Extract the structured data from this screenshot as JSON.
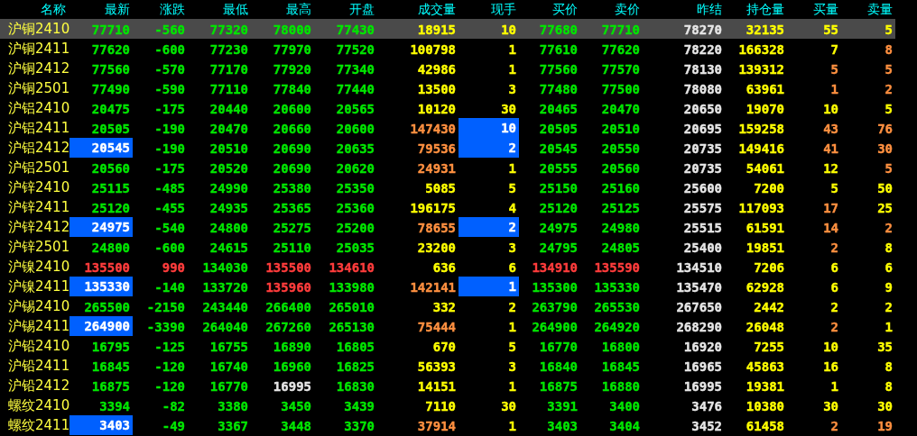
{
  "columns": [
    "名称",
    "最新",
    "涨跌",
    "最低",
    "最高",
    "开盘",
    "成交量",
    "现手",
    "买价",
    "卖价",
    "昨结",
    "持仓量",
    "买量",
    "卖量"
  ],
  "rows": [
    {
      "name": "沪铜2410",
      "selected": true,
      "cells": [
        {
          "text": "77710",
          "color": "#00e600"
        },
        {
          "text": "-560",
          "color": "#00e600"
        },
        {
          "text": "77320",
          "color": "#00e600"
        },
        {
          "text": "78000",
          "color": "#00e600"
        },
        {
          "text": "77430",
          "color": "#00e600"
        },
        {
          "text": "18915",
          "color": "#ffff00"
        },
        {
          "text": "10",
          "color": "#ffff00"
        },
        {
          "text": "77680",
          "color": "#00e600"
        },
        {
          "text": "77710",
          "color": "#00e600"
        },
        {
          "text": "78270",
          "color": "#e6e6e6"
        },
        {
          "text": "32135",
          "color": "#ffff00"
        },
        {
          "text": "55",
          "color": "#ffff00"
        },
        {
          "text": "5",
          "color": "#ffff00"
        }
      ]
    },
    {
      "name": "沪铜2411",
      "selected": false,
      "cells": [
        {
          "text": "77620",
          "color": "#00e600"
        },
        {
          "text": "-600",
          "color": "#00e600"
        },
        {
          "text": "77230",
          "color": "#00e600"
        },
        {
          "text": "77970",
          "color": "#00e600"
        },
        {
          "text": "77520",
          "color": "#00e600"
        },
        {
          "text": "100798",
          "color": "#ffff00"
        },
        {
          "text": "1",
          "color": "#ffff00"
        },
        {
          "text": "77610",
          "color": "#00e600"
        },
        {
          "text": "77620",
          "color": "#00e600"
        },
        {
          "text": "78220",
          "color": "#e6e6e6"
        },
        {
          "text": "166328",
          "color": "#ffff00"
        },
        {
          "text": "7",
          "color": "#ffff00"
        },
        {
          "text": "8",
          "color": "#ff9040"
        }
      ]
    },
    {
      "name": "沪铜2412",
      "selected": false,
      "cells": [
        {
          "text": "77560",
          "color": "#00e600"
        },
        {
          "text": "-570",
          "color": "#00e600"
        },
        {
          "text": "77170",
          "color": "#00e600"
        },
        {
          "text": "77920",
          "color": "#00e600"
        },
        {
          "text": "77340",
          "color": "#00e600"
        },
        {
          "text": "42986",
          "color": "#ffff00"
        },
        {
          "text": "1",
          "color": "#ffff00"
        },
        {
          "text": "77560",
          "color": "#00e600"
        },
        {
          "text": "77570",
          "color": "#00e600"
        },
        {
          "text": "78130",
          "color": "#e6e6e6"
        },
        {
          "text": "139312",
          "color": "#ffff00"
        },
        {
          "text": "5",
          "color": "#ff9040"
        },
        {
          "text": "5",
          "color": "#ff9040"
        }
      ]
    },
    {
      "name": "沪铜2501",
      "selected": false,
      "cells": [
        {
          "text": "77490",
          "color": "#00e600"
        },
        {
          "text": "-590",
          "color": "#00e600"
        },
        {
          "text": "77110",
          "color": "#00e600"
        },
        {
          "text": "77840",
          "color": "#00e600"
        },
        {
          "text": "77440",
          "color": "#00e600"
        },
        {
          "text": "13500",
          "color": "#ffff00"
        },
        {
          "text": "3",
          "color": "#ffff00"
        },
        {
          "text": "77480",
          "color": "#00e600"
        },
        {
          "text": "77500",
          "color": "#00e600"
        },
        {
          "text": "78080",
          "color": "#e6e6e6"
        },
        {
          "text": "63961",
          "color": "#ffff00"
        },
        {
          "text": "1",
          "color": "#ff9040"
        },
        {
          "text": "2",
          "color": "#ff9040"
        }
      ]
    },
    {
      "name": "沪铝2410",
      "selected": false,
      "cells": [
        {
          "text": "20475",
          "color": "#00e600"
        },
        {
          "text": "-175",
          "color": "#00e600"
        },
        {
          "text": "20440",
          "color": "#00e600"
        },
        {
          "text": "20600",
          "color": "#00e600"
        },
        {
          "text": "20565",
          "color": "#00e600"
        },
        {
          "text": "10120",
          "color": "#ffff00"
        },
        {
          "text": "30",
          "color": "#ffff00"
        },
        {
          "text": "20465",
          "color": "#00e600"
        },
        {
          "text": "20470",
          "color": "#00e600"
        },
        {
          "text": "20650",
          "color": "#e6e6e6"
        },
        {
          "text": "19070",
          "color": "#ffff00"
        },
        {
          "text": "10",
          "color": "#ffff00"
        },
        {
          "text": "5",
          "color": "#ffff00"
        }
      ]
    },
    {
      "name": "沪铝2411",
      "selected": false,
      "cells": [
        {
          "text": "20505",
          "color": "#00e600"
        },
        {
          "text": "-190",
          "color": "#00e600"
        },
        {
          "text": "20470",
          "color": "#00e600"
        },
        {
          "text": "20660",
          "color": "#00e600"
        },
        {
          "text": "20600",
          "color": "#00e600"
        },
        {
          "text": "147430",
          "color": "#ff9040"
        },
        {
          "text": "10",
          "flash": true
        },
        {
          "text": "20505",
          "color": "#00e600"
        },
        {
          "text": "20510",
          "color": "#00e600"
        },
        {
          "text": "20695",
          "color": "#e6e6e6"
        },
        {
          "text": "159258",
          "color": "#ffff00"
        },
        {
          "text": "43",
          "color": "#ff9040"
        },
        {
          "text": "76",
          "color": "#ff9040"
        }
      ]
    },
    {
      "name": "沪铝2412",
      "selected": false,
      "cells": [
        {
          "text": "20545",
          "flash": true
        },
        {
          "text": "-190",
          "color": "#00e600"
        },
        {
          "text": "20510",
          "color": "#00e600"
        },
        {
          "text": "20690",
          "color": "#00e600"
        },
        {
          "text": "20635",
          "color": "#00e600"
        },
        {
          "text": "79536",
          "color": "#ff9040"
        },
        {
          "text": "2",
          "flash": true
        },
        {
          "text": "20545",
          "color": "#00e600"
        },
        {
          "text": "20550",
          "color": "#00e600"
        },
        {
          "text": "20735",
          "color": "#e6e6e6"
        },
        {
          "text": "149416",
          "color": "#ffff00"
        },
        {
          "text": "41",
          "color": "#ff9040"
        },
        {
          "text": "30",
          "color": "#ff9040"
        }
      ]
    },
    {
      "name": "沪铝2501",
      "selected": false,
      "cells": [
        {
          "text": "20560",
          "color": "#00e600"
        },
        {
          "text": "-175",
          "color": "#00e600"
        },
        {
          "text": "20520",
          "color": "#00e600"
        },
        {
          "text": "20690",
          "color": "#00e600"
        },
        {
          "text": "20620",
          "color": "#00e600"
        },
        {
          "text": "24931",
          "color": "#ff9040"
        },
        {
          "text": "1",
          "color": "#ffff00"
        },
        {
          "text": "20555",
          "color": "#00e600"
        },
        {
          "text": "20560",
          "color": "#00e600"
        },
        {
          "text": "20735",
          "color": "#e6e6e6"
        },
        {
          "text": "54061",
          "color": "#ffff00"
        },
        {
          "text": "12",
          "color": "#ffff00"
        },
        {
          "text": "5",
          "color": "#ff9040"
        }
      ]
    },
    {
      "name": "沪锌2410",
      "selected": false,
      "cells": [
        {
          "text": "25115",
          "color": "#00e600"
        },
        {
          "text": "-485",
          "color": "#00e600"
        },
        {
          "text": "24990",
          "color": "#00e600"
        },
        {
          "text": "25380",
          "color": "#00e600"
        },
        {
          "text": "25350",
          "color": "#00e600"
        },
        {
          "text": "5085",
          "color": "#ffff00"
        },
        {
          "text": "5",
          "color": "#ffff00"
        },
        {
          "text": "25150",
          "color": "#00e600"
        },
        {
          "text": "25160",
          "color": "#00e600"
        },
        {
          "text": "25600",
          "color": "#e6e6e6"
        },
        {
          "text": "7200",
          "color": "#ffff00"
        },
        {
          "text": "5",
          "color": "#ffff00"
        },
        {
          "text": "50",
          "color": "#ffff00"
        }
      ]
    },
    {
      "name": "沪锌2411",
      "selected": false,
      "cells": [
        {
          "text": "25120",
          "color": "#00e600"
        },
        {
          "text": "-455",
          "color": "#00e600"
        },
        {
          "text": "24935",
          "color": "#00e600"
        },
        {
          "text": "25365",
          "color": "#00e600"
        },
        {
          "text": "25360",
          "color": "#00e600"
        },
        {
          "text": "196175",
          "color": "#ffff00"
        },
        {
          "text": "4",
          "color": "#ffff00"
        },
        {
          "text": "25120",
          "color": "#00e600"
        },
        {
          "text": "25125",
          "color": "#00e600"
        },
        {
          "text": "25575",
          "color": "#e6e6e6"
        },
        {
          "text": "117093",
          "color": "#ffff00"
        },
        {
          "text": "17",
          "color": "#ff9040"
        },
        {
          "text": "25",
          "color": "#ffff00"
        }
      ]
    },
    {
      "name": "沪锌2412",
      "selected": false,
      "cells": [
        {
          "text": "24975",
          "flash": true
        },
        {
          "text": "-540",
          "color": "#00e600"
        },
        {
          "text": "24800",
          "color": "#00e600"
        },
        {
          "text": "25275",
          "color": "#00e600"
        },
        {
          "text": "25200",
          "color": "#00e600"
        },
        {
          "text": "78655",
          "color": "#ff9040"
        },
        {
          "text": "2",
          "flash": true
        },
        {
          "text": "24975",
          "color": "#00e600"
        },
        {
          "text": "24980",
          "color": "#00e600"
        },
        {
          "text": "25515",
          "color": "#e6e6e6"
        },
        {
          "text": "61591",
          "color": "#ffff00"
        },
        {
          "text": "14",
          "color": "#ff9040"
        },
        {
          "text": "2",
          "color": "#ff9040"
        }
      ]
    },
    {
      "name": "沪锌2501",
      "selected": false,
      "cells": [
        {
          "text": "24800",
          "color": "#00e600"
        },
        {
          "text": "-600",
          "color": "#00e600"
        },
        {
          "text": "24615",
          "color": "#00e600"
        },
        {
          "text": "25110",
          "color": "#00e600"
        },
        {
          "text": "25035",
          "color": "#00e600"
        },
        {
          "text": "23200",
          "color": "#ffff00"
        },
        {
          "text": "3",
          "color": "#ffff00"
        },
        {
          "text": "24795",
          "color": "#00e600"
        },
        {
          "text": "24805",
          "color": "#00e600"
        },
        {
          "text": "25400",
          "color": "#e6e6e6"
        },
        {
          "text": "19851",
          "color": "#ffff00"
        },
        {
          "text": "2",
          "color": "#ff9040"
        },
        {
          "text": "8",
          "color": "#ffff00"
        }
      ]
    },
    {
      "name": "沪镍2410",
      "selected": false,
      "cells": [
        {
          "text": "135500",
          "color": "#ff3c3c"
        },
        {
          "text": "990",
          "color": "#ff3c3c"
        },
        {
          "text": "134030",
          "color": "#00e600"
        },
        {
          "text": "135500",
          "color": "#ff3c3c"
        },
        {
          "text": "134610",
          "color": "#ff3c3c"
        },
        {
          "text": "636",
          "color": "#ffff00"
        },
        {
          "text": "6",
          "color": "#ffff00"
        },
        {
          "text": "134910",
          "color": "#ff3c3c"
        },
        {
          "text": "135590",
          "color": "#ff3c3c"
        },
        {
          "text": "134510",
          "color": "#e6e6e6"
        },
        {
          "text": "7206",
          "color": "#ffff00"
        },
        {
          "text": "6",
          "color": "#ffff00"
        },
        {
          "text": "6",
          "color": "#ffff00"
        }
      ]
    },
    {
      "name": "沪镍2411",
      "selected": false,
      "cells": [
        {
          "text": "135330",
          "flash": true
        },
        {
          "text": "-140",
          "color": "#00e600"
        },
        {
          "text": "133720",
          "color": "#00e600"
        },
        {
          "text": "135960",
          "color": "#ff3c3c"
        },
        {
          "text": "133980",
          "color": "#00e600"
        },
        {
          "text": "142141",
          "color": "#ff9040"
        },
        {
          "text": "1",
          "flash": true
        },
        {
          "text": "135300",
          "color": "#00e600"
        },
        {
          "text": "135330",
          "color": "#00e600"
        },
        {
          "text": "135470",
          "color": "#e6e6e6"
        },
        {
          "text": "62928",
          "color": "#ffff00"
        },
        {
          "text": "6",
          "color": "#ffff00"
        },
        {
          "text": "9",
          "color": "#ffff00"
        }
      ]
    },
    {
      "name": "沪锡2410",
      "selected": false,
      "cells": [
        {
          "text": "265500",
          "color": "#00e600"
        },
        {
          "text": "-2150",
          "color": "#00e600"
        },
        {
          "text": "243440",
          "color": "#00e600"
        },
        {
          "text": "266400",
          "color": "#00e600"
        },
        {
          "text": "265010",
          "color": "#00e600"
        },
        {
          "text": "332",
          "color": "#ffff00"
        },
        {
          "text": "2",
          "color": "#ffff00"
        },
        {
          "text": "263790",
          "color": "#00e600"
        },
        {
          "text": "265530",
          "color": "#00e600"
        },
        {
          "text": "267650",
          "color": "#e6e6e6"
        },
        {
          "text": "2442",
          "color": "#ffff00"
        },
        {
          "text": "2",
          "color": "#ffff00"
        },
        {
          "text": "2",
          "color": "#ffff00"
        }
      ]
    },
    {
      "name": "沪锡2411",
      "selected": false,
      "cells": [
        {
          "text": "264900",
          "flash": true
        },
        {
          "text": "-3390",
          "color": "#00e600"
        },
        {
          "text": "264040",
          "color": "#00e600"
        },
        {
          "text": "267260",
          "color": "#00e600"
        },
        {
          "text": "265130",
          "color": "#00e600"
        },
        {
          "text": "75444",
          "color": "#ff9040"
        },
        {
          "text": "1",
          "color": "#ffff00"
        },
        {
          "text": "264900",
          "color": "#00e600"
        },
        {
          "text": "264920",
          "color": "#00e600"
        },
        {
          "text": "268290",
          "color": "#e6e6e6"
        },
        {
          "text": "26048",
          "color": "#ffff00"
        },
        {
          "text": "2",
          "color": "#ff9040"
        },
        {
          "text": "1",
          "color": "#ffff00"
        }
      ]
    },
    {
      "name": "沪铅2410",
      "selected": false,
      "cells": [
        {
          "text": "16795",
          "color": "#00e600"
        },
        {
          "text": "-125",
          "color": "#00e600"
        },
        {
          "text": "16755",
          "color": "#00e600"
        },
        {
          "text": "16890",
          "color": "#00e600"
        },
        {
          "text": "16805",
          "color": "#00e600"
        },
        {
          "text": "670",
          "color": "#ffff00"
        },
        {
          "text": "5",
          "color": "#ffff00"
        },
        {
          "text": "16770",
          "color": "#00e600"
        },
        {
          "text": "16800",
          "color": "#00e600"
        },
        {
          "text": "16920",
          "color": "#e6e6e6"
        },
        {
          "text": "7255",
          "color": "#ffff00"
        },
        {
          "text": "10",
          "color": "#ffff00"
        },
        {
          "text": "35",
          "color": "#ffff00"
        }
      ]
    },
    {
      "name": "沪铅2411",
      "selected": false,
      "cells": [
        {
          "text": "16845",
          "color": "#00e600"
        },
        {
          "text": "-120",
          "color": "#00e600"
        },
        {
          "text": "16740",
          "color": "#00e600"
        },
        {
          "text": "16960",
          "color": "#00e600"
        },
        {
          "text": "16825",
          "color": "#00e600"
        },
        {
          "text": "56393",
          "color": "#ffff00"
        },
        {
          "text": "3",
          "color": "#ffff00"
        },
        {
          "text": "16840",
          "color": "#00e600"
        },
        {
          "text": "16845",
          "color": "#00e600"
        },
        {
          "text": "16965",
          "color": "#e6e6e6"
        },
        {
          "text": "45863",
          "color": "#ffff00"
        },
        {
          "text": "16",
          "color": "#ffff00"
        },
        {
          "text": "8",
          "color": "#ffff00"
        }
      ]
    },
    {
      "name": "沪铅2412",
      "selected": false,
      "cells": [
        {
          "text": "16875",
          "color": "#00e600"
        },
        {
          "text": "-120",
          "color": "#00e600"
        },
        {
          "text": "16770",
          "color": "#00e600"
        },
        {
          "text": "16995",
          "color": "#e6e6e6"
        },
        {
          "text": "16830",
          "color": "#00e600"
        },
        {
          "text": "14151",
          "color": "#ffff00"
        },
        {
          "text": "1",
          "color": "#ffff00"
        },
        {
          "text": "16875",
          "color": "#00e600"
        },
        {
          "text": "16880",
          "color": "#00e600"
        },
        {
          "text": "16995",
          "color": "#e6e6e6"
        },
        {
          "text": "19381",
          "color": "#ffff00"
        },
        {
          "text": "1",
          "color": "#ffff00"
        },
        {
          "text": "8",
          "color": "#ffff00"
        }
      ]
    },
    {
      "name": "螺纹2410",
      "selected": false,
      "cells": [
        {
          "text": "3394",
          "color": "#00e600"
        },
        {
          "text": "-82",
          "color": "#00e600"
        },
        {
          "text": "3380",
          "color": "#00e600"
        },
        {
          "text": "3450",
          "color": "#00e600"
        },
        {
          "text": "3439",
          "color": "#00e600"
        },
        {
          "text": "7110",
          "color": "#ffff00"
        },
        {
          "text": "30",
          "color": "#ffff00"
        },
        {
          "text": "3391",
          "color": "#00e600"
        },
        {
          "text": "3400",
          "color": "#00e600"
        },
        {
          "text": "3476",
          "color": "#e6e6e6"
        },
        {
          "text": "10380",
          "color": "#ffff00"
        },
        {
          "text": "30",
          "color": "#ffff00"
        },
        {
          "text": "30",
          "color": "#ffff00"
        }
      ]
    },
    {
      "name": "螺纹2411",
      "selected": false,
      "cells": [
        {
          "text": "3403",
          "flash": true
        },
        {
          "text": "-49",
          "color": "#00e600"
        },
        {
          "text": "3367",
          "color": "#00e600"
        },
        {
          "text": "3448",
          "color": "#00e600"
        },
        {
          "text": "3370",
          "color": "#00e600"
        },
        {
          "text": "37914",
          "color": "#ff9040"
        },
        {
          "text": "1",
          "color": "#ffff00"
        },
        {
          "text": "3403",
          "color": "#00e600"
        },
        {
          "text": "3404",
          "color": "#00e600"
        },
        {
          "text": "3452",
          "color": "#e6e6e6"
        },
        {
          "text": "61458",
          "color": "#ffff00"
        },
        {
          "text": "2",
          "color": "#ff9040"
        },
        {
          "text": "19",
          "color": "#ff9040"
        }
      ]
    }
  ]
}
